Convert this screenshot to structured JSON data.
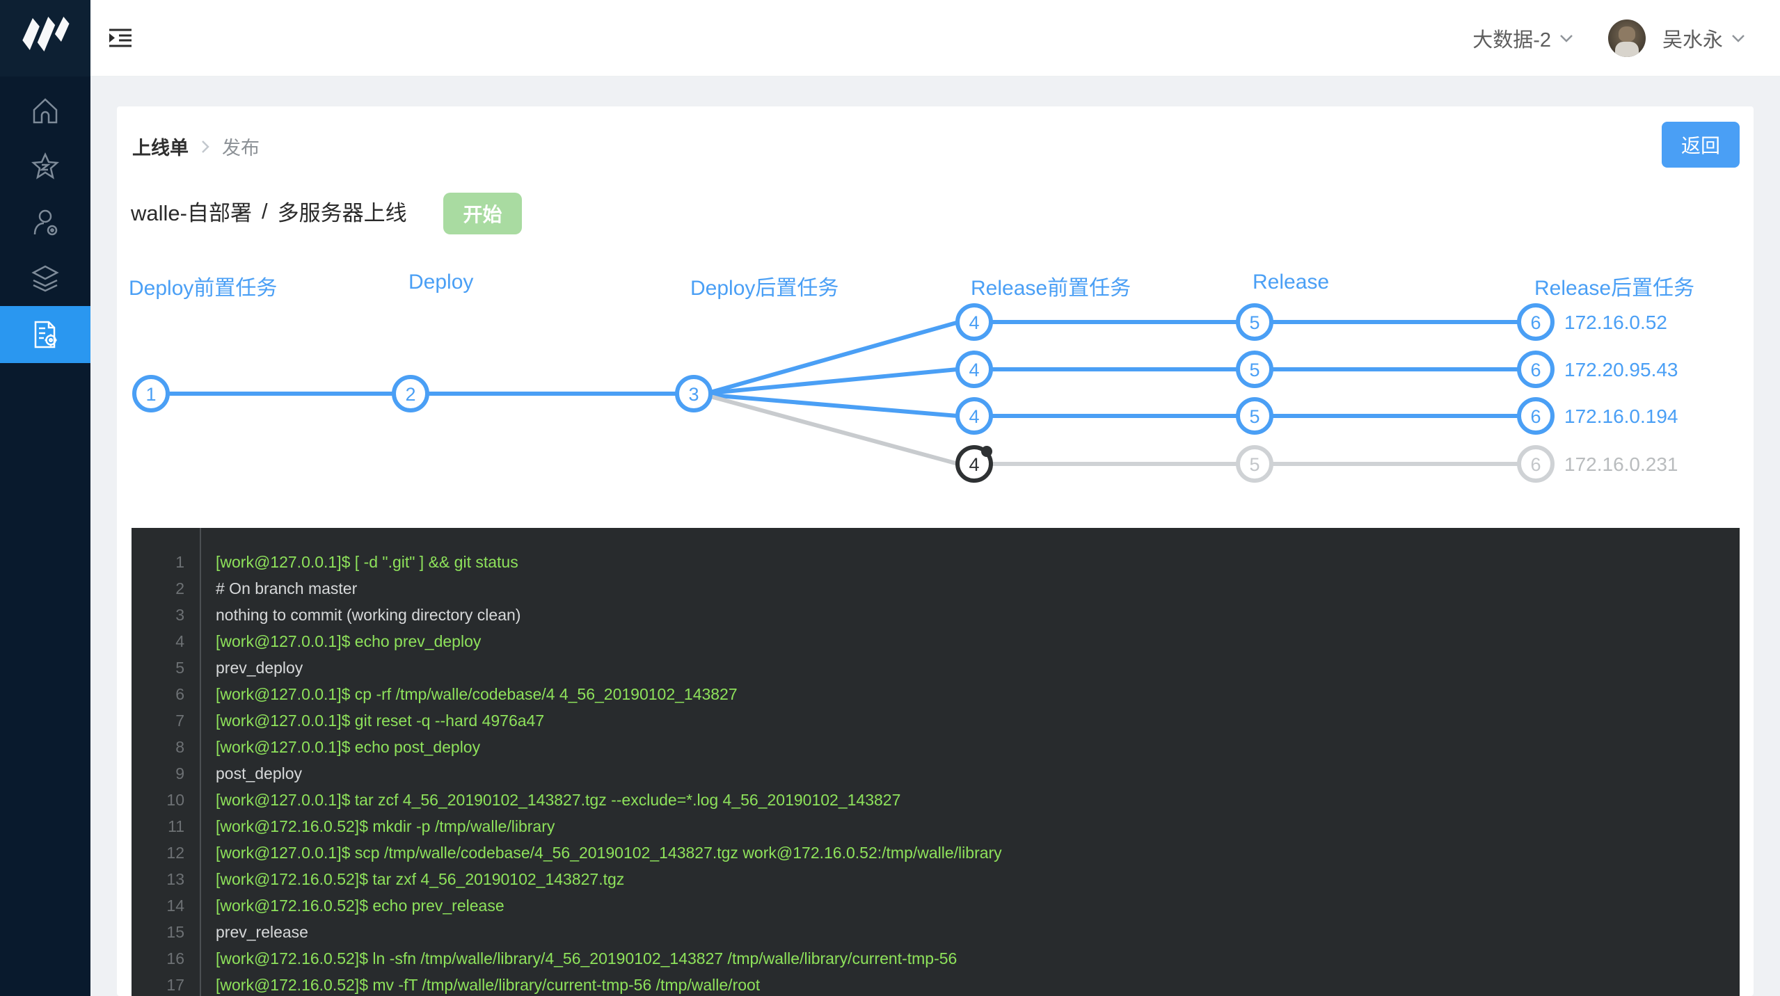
{
  "navbar": {
    "workspace_label": "大数据-2",
    "user_name": "吴水永"
  },
  "sidebar": {
    "items": [
      {
        "icon": "home-icon",
        "active": false
      },
      {
        "icon": "star-icon",
        "active": false
      },
      {
        "icon": "user-settings-icon",
        "active": false
      },
      {
        "icon": "layers-icon",
        "active": false
      },
      {
        "icon": "deploy-doc-icon",
        "active": true
      }
    ]
  },
  "breadcrumb": {
    "root": "上线单",
    "current": "发布"
  },
  "actions": {
    "back_label": "返回",
    "start_label": "开始"
  },
  "title": {
    "project": "walle-自部署",
    "separator": "/",
    "task": "多服务器上线"
  },
  "pipeline": {
    "columns": [
      "Deploy前置任务",
      "Deploy",
      "Deploy后置任务",
      "Release前置任务",
      "Release",
      "Release后置任务"
    ],
    "main_nodes": [
      "1",
      "2",
      "3"
    ],
    "branches": [
      {
        "n4": "4",
        "n5": "5",
        "n6": "6",
        "ip": "172.16.0.52",
        "status": "done"
      },
      {
        "n4": "4",
        "n5": "5",
        "n6": "6",
        "ip": "172.20.95.43",
        "status": "done"
      },
      {
        "n4": "4",
        "n5": "5",
        "n6": "6",
        "ip": "172.16.0.194",
        "status": "done"
      },
      {
        "n4": "4",
        "n5": "5",
        "n6": "6",
        "ip": "172.16.0.231",
        "status": "running"
      }
    ]
  },
  "colors": {
    "accent_blue": "#4a9ff5",
    "sidebar_active_blue": "#2a97f0",
    "start_green": "#a9dba1",
    "pending_gray": "#cfd2d5",
    "running_dark": "#2e3133",
    "console_bg": "#282b2d",
    "console_cmd_green": "#8ee25b",
    "console_out_gray": "#d7d9da"
  },
  "console": {
    "lines": [
      {
        "no": "1",
        "text": "[work@127.0.0.1]$ [ -d \".git\" ] && git status",
        "type": "cmd"
      },
      {
        "no": "2",
        "text": "# On branch master",
        "type": "out"
      },
      {
        "no": "3",
        "text": "nothing to commit (working directory clean)",
        "type": "out"
      },
      {
        "no": "4",
        "text": "[work@127.0.0.1]$ echo prev_deploy",
        "type": "cmd"
      },
      {
        "no": "5",
        "text": "prev_deploy",
        "type": "out"
      },
      {
        "no": "6",
        "text": "[work@127.0.0.1]$ cp -rf /tmp/walle/codebase/4 4_56_20190102_143827",
        "type": "cmd"
      },
      {
        "no": "7",
        "text": "[work@127.0.0.1]$ git reset -q --hard 4976a47",
        "type": "cmd"
      },
      {
        "no": "8",
        "text": "[work@127.0.0.1]$ echo post_deploy",
        "type": "cmd"
      },
      {
        "no": "9",
        "text": "post_deploy",
        "type": "out"
      },
      {
        "no": "10",
        "text": "[work@127.0.0.1]$ tar zcf 4_56_20190102_143827.tgz --exclude=*.log 4_56_20190102_143827",
        "type": "cmd"
      },
      {
        "no": "11",
        "text": "[work@172.16.0.52]$ mkdir -p /tmp/walle/library",
        "type": "cmd"
      },
      {
        "no": "12",
        "text": "[work@127.0.0.1]$ scp /tmp/walle/codebase/4_56_20190102_143827.tgz work@172.16.0.52:/tmp/walle/library",
        "type": "cmd"
      },
      {
        "no": "13",
        "text": "[work@172.16.0.52]$ tar zxf 4_56_20190102_143827.tgz",
        "type": "cmd"
      },
      {
        "no": "14",
        "text": "[work@172.16.0.52]$ echo prev_release",
        "type": "cmd"
      },
      {
        "no": "15",
        "text": "prev_release",
        "type": "out"
      },
      {
        "no": "16",
        "text": "[work@172.16.0.52]$ ln -sfn /tmp/walle/library/4_56_20190102_143827 /tmp/walle/library/current-tmp-56",
        "type": "cmd"
      },
      {
        "no": "17",
        "text": "[work@172.16.0.52]$ mv -fT /tmp/walle/library/current-tmp-56 /tmp/walle/root",
        "type": "cmd"
      }
    ]
  }
}
